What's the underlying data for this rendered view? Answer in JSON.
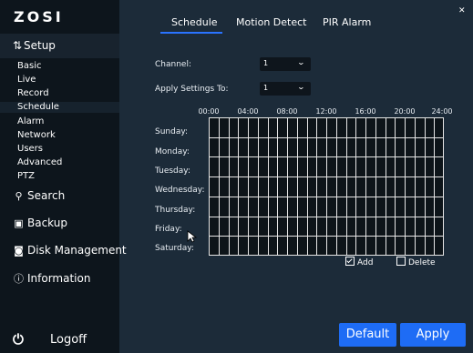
{
  "brand": {
    "logo_text": "ZOSI"
  },
  "sidebar": {
    "setup_label": "Setup",
    "setup_icon": "sliders-icon",
    "sub_items": [
      "Basic",
      "Live",
      "Record",
      "Schedule",
      "Alarm",
      "Network",
      "Users",
      "Advanced",
      "PTZ"
    ],
    "active_sub_item": "Schedule",
    "search_label": "Search",
    "backup_label": "Backup",
    "disk_label": "Disk Management",
    "info_label": "Information",
    "logoff_label": "Logoff"
  },
  "tabs": {
    "schedule": "Schedule",
    "motion": "Motion Detect",
    "pir": "PIR Alarm",
    "active": "Schedule"
  },
  "form": {
    "channel_label": "Channel:",
    "channel_value": "1",
    "apply_to_label": "Apply Settings To:",
    "apply_to_value": "1"
  },
  "schedule": {
    "time_labels": [
      "00:00",
      "04:00",
      "08:00",
      "12:00",
      "16:00",
      "20:00",
      "24:00"
    ],
    "days": [
      "Sunday:",
      "Monday:",
      "Tuesday:",
      "Wednesday:",
      "Thursday:",
      "Friday:",
      "Saturday:"
    ],
    "add_label": "Add",
    "delete_label": "Delete",
    "add_checked": true,
    "delete_checked": false
  },
  "buttons": {
    "default_label": "Default",
    "apply_label": "Apply"
  },
  "colors": {
    "accent": "#1e6cf5",
    "background": "#1c2b39",
    "sidebar": "#0d151c"
  }
}
